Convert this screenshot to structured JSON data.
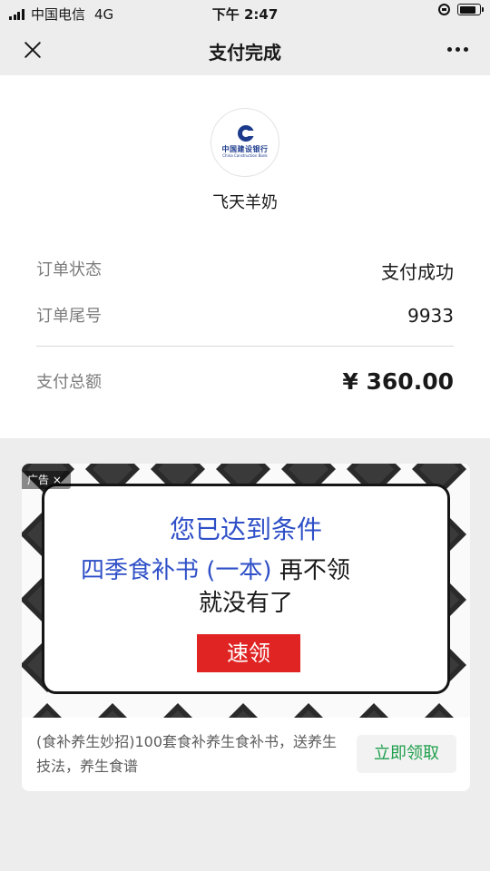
{
  "status_bar": {
    "carrier": "中国电信",
    "network": "4G",
    "time": "下午 2:47",
    "battery_level": 0.85
  },
  "nav": {
    "title": "支付完成",
    "icons": [
      "close-icon",
      "more-icon"
    ]
  },
  "merchant": {
    "logo_cn": "中国建设银行",
    "logo_en": "China Construction Bank",
    "name": "飞天羊奶"
  },
  "order": {
    "rows": [
      {
        "label": "订单状态",
        "value": "支付成功"
      },
      {
        "label": "订单尾号",
        "value": "9933"
      }
    ],
    "total_label": "支付总额",
    "total_value": "¥ 360.00"
  },
  "ad": {
    "tag": "广告",
    "popup": {
      "line1": "您已达到条件",
      "line2_highlight": "四季食补书 (一本)",
      "line2_rest": " 再不领",
      "line3": "就没有了",
      "button": "速领"
    },
    "description": "(食补养生妙招)100套食补养生食补书，送养生技法，养生食谱",
    "cta": "立即领取"
  },
  "colors": {
    "accent_blue": "#2e4fc7",
    "button_red": "#e02424",
    "cta_green": "#1e9e4a",
    "bank_blue": "#1b3a8c"
  }
}
